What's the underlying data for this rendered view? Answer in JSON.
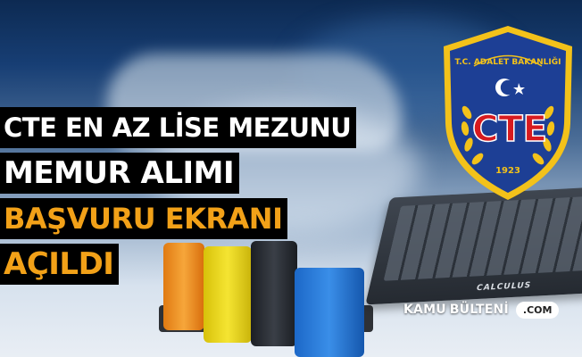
{
  "headline": {
    "line1": "CTE EN AZ LİSE MEZUNU",
    "line2": "MEMUR ALIMI",
    "line3": "BAŞVURU EKRANI",
    "line4": "AÇILDI",
    "colors": {
      "white": "#ffffff",
      "orange": "#f2a118",
      "band": "#000000"
    }
  },
  "badge": {
    "top_text": "T.C. ADALET BAKANLIĞI",
    "letters": "CTE",
    "year": "1923",
    "colors": {
      "shield": "#1d3f95",
      "gold": "#f3c21a",
      "red": "#d71a1f"
    },
    "icons": [
      "crescent-star-icon",
      "laurel-icon"
    ]
  },
  "keyboard": {
    "label": "CALCULUS"
  },
  "watermark": {
    "part1": "KAMU",
    "part2": "BÜLTENİ",
    "suffix": ".COM"
  }
}
